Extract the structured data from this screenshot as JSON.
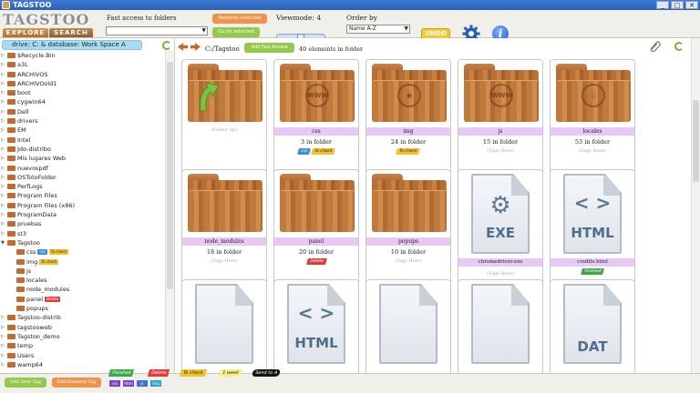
{
  "window": {
    "title": "TAGSTOO",
    "minimize": "_",
    "maximize": "□",
    "close": "✕"
  },
  "header": {
    "logo": "TAGSTOO",
    "tabs": [
      "EXPLORE",
      "SEARCH"
    ],
    "fast_access_label": "Fast access to folders",
    "remove_selected": "Remove selected",
    "go_selected": "Go to selected",
    "viewmode_label": "Viewmode: 4",
    "order_label": "Order by",
    "order_value": "Name A-Z",
    "undo": "UNDO"
  },
  "left": {
    "drive_label": "drive: C: & database: Work Space A",
    "tree": [
      {
        "label": "$Recycle.Bin",
        "level": 0
      },
      {
        "label": "a3L",
        "level": 0
      },
      {
        "label": "ARCHIVOS",
        "level": 0
      },
      {
        "label": "ARCHIVOold1",
        "level": 0
      },
      {
        "label": "boot",
        "level": 0
      },
      {
        "label": "cygwin64",
        "level": 0
      },
      {
        "label": "Dell",
        "level": 0
      },
      {
        "label": "drivers",
        "level": 0
      },
      {
        "label": "EM",
        "level": 0
      },
      {
        "label": "Intel",
        "level": 0
      },
      {
        "label": "Jdo-distribo",
        "level": 0
      },
      {
        "label": "Mis lugares Web",
        "level": 0
      },
      {
        "label": "nuevospdf",
        "level": 0
      },
      {
        "label": "OSTotoFolder",
        "level": 0
      },
      {
        "label": "PerfLogs",
        "level": 0
      },
      {
        "label": "Program Files",
        "level": 0
      },
      {
        "label": "Program Files (x86)",
        "level": 0
      },
      {
        "label": "ProgramData",
        "level": 0
      },
      {
        "label": "pruebas",
        "level": 0
      },
      {
        "label": "st3",
        "level": 0
      },
      {
        "label": "Tagstoo",
        "level": 0,
        "expanded": true
      },
      {
        "label": "css",
        "level": 1,
        "tags": [
          {
            "text": "css",
            "color": "#3b8fd6"
          },
          {
            "text": "To check",
            "color": "#f2c12e"
          }
        ]
      },
      {
        "label": "img",
        "level": 1,
        "tags": [
          {
            "text": "To check",
            "color": "#f2c12e"
          }
        ]
      },
      {
        "label": "js",
        "level": 1
      },
      {
        "label": "locales",
        "level": 1
      },
      {
        "label": "node_modules",
        "level": 1
      },
      {
        "label": "panel",
        "level": 1,
        "tags": [
          {
            "text": "Delete",
            "color": "#e23a3a"
          }
        ]
      },
      {
        "label": "popups",
        "level": 1
      },
      {
        "label": "Tagstoo-distrib",
        "level": 0
      },
      {
        "label": "tagstooweb",
        "level": 0
      },
      {
        "label": "Tagstoo_demo",
        "level": 0
      },
      {
        "label": "temp",
        "level": 0
      },
      {
        "label": "Users",
        "level": 0
      },
      {
        "label": "wamp64",
        "level": 0
      }
    ]
  },
  "main": {
    "path": "C:/Tagstoo",
    "add_fav": "Add Fast Access",
    "elements": "40 elements in folder",
    "cards": [
      {
        "type": "up",
        "name": "",
        "hint": "(Folder up)"
      },
      {
        "type": "folder",
        "emblem": "css",
        "name": "css",
        "count": "3 in folder",
        "tags": [
          {
            "text": "css",
            "color": "#3b8fd6"
          },
          {
            "text": "To check",
            "color": "#f2c12e"
          }
        ]
      },
      {
        "type": "folder",
        "emblem": "img",
        "name": "img",
        "count": "24 in folder",
        "tags": [
          {
            "text": "To check",
            "color": "#f2c12e"
          }
        ]
      },
      {
        "type": "folder",
        "emblem": "www",
        "name": "js",
        "count": "15 in folder",
        "hint": "(Tags Here)"
      },
      {
        "type": "folder",
        "emblem": "doc",
        "name": "locales",
        "count": "53 in folder",
        "hint": "(Tags Here)"
      },
      {
        "type": "folder",
        "emblem": "",
        "name": "node_modules",
        "count": "18 in folder",
        "hint": "(Tags Here)"
      },
      {
        "type": "folder",
        "emblem": "",
        "name": "panel",
        "count": "20 in folder",
        "tags": [
          {
            "text": "Delete",
            "color": "#e23a3a"
          }
        ]
      },
      {
        "type": "folder",
        "emblem": "",
        "name": "popups",
        "count": "10 in folder",
        "hint": "(Tags Here)"
      },
      {
        "type": "file",
        "ext": "EXE",
        "name": "chromedriver.exe",
        "hint": "(Tags Here)"
      },
      {
        "type": "file",
        "ext": "HTML",
        "name": "credits.html",
        "tags": [
          {
            "text": "Finished",
            "color": "#3aa84a"
          }
        ]
      },
      {
        "type": "file",
        "ext": "",
        "name": ""
      },
      {
        "type": "file",
        "ext": "HTML",
        "name": ""
      },
      {
        "type": "file",
        "ext": "",
        "name": ""
      },
      {
        "type": "file",
        "ext": "",
        "name": ""
      },
      {
        "type": "file",
        "ext": "DAT",
        "name": ""
      }
    ]
  },
  "footer": {
    "add_tag": "Add New Tag",
    "edit_tag": "Edit/Remove Tag",
    "legend": [
      {
        "text": "Finished",
        "color": "#3aa84a"
      },
      {
        "text": "Delete",
        "color": "#e23a3a"
      },
      {
        "text": "To check",
        "color": "#f2c12e"
      },
      {
        "text": "1 week",
        "color": "#f6f08a"
      },
      {
        "text": "Send to A",
        "color": "#111111"
      }
    ],
    "squares": [
      {
        "text": "css",
        "color": "#7b3fc8"
      },
      {
        "text": "html",
        "color": "#7b3fc8"
      },
      {
        "text": "js",
        "color": "#3b6fd6"
      },
      {
        "text": "img",
        "color": "#2aa7c8"
      }
    ]
  }
}
